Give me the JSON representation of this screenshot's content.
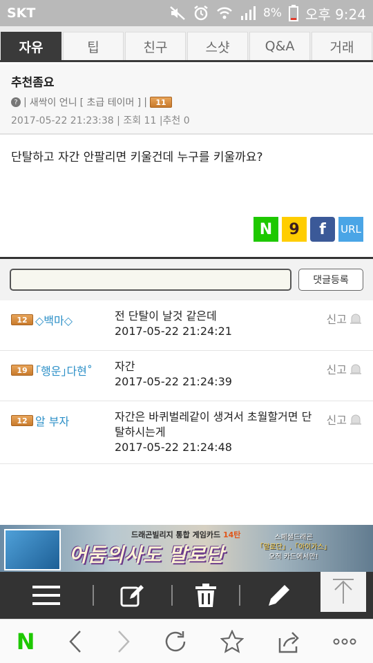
{
  "status_bar": {
    "carrier": "SKT",
    "battery": "8%",
    "time": "오후 9:24"
  },
  "tabs": [
    {
      "label": "자유",
      "active": true
    },
    {
      "label": "팁",
      "active": false
    },
    {
      "label": "친구",
      "active": false
    },
    {
      "label": "스샷",
      "active": false
    },
    {
      "label": "Q&A",
      "active": false
    },
    {
      "label": "거래",
      "active": false
    }
  ],
  "post": {
    "title": "추천좀요",
    "author_prefix": "|",
    "author": "새싹이 언니",
    "rank": "[ 초급 테이머 ]",
    "level_sep": "|",
    "level": "11",
    "date": "2017-05-22 21:23:38",
    "views_label": "| 조회 11",
    "recommend_label": "|추천 0",
    "body": "단탈하고 자간 안팔리면 키울건데 누구를 키울까요?"
  },
  "share": {
    "naver": "N",
    "kakao": "9",
    "facebook": "f",
    "url": "URL"
  },
  "comment_form": {
    "placeholder": "",
    "submit_label": "댓글등록"
  },
  "comments": [
    {
      "level": "12",
      "user": "◇백마◇",
      "text": "전 단탈이 날것 같은데",
      "date": "2017-05-22 21:24:21",
      "report": "신고"
    },
    {
      "level": "19",
      "user": "｢행운｣다현˚",
      "text": "자간",
      "date": "2017-05-22 21:24:39",
      "report": "신고"
    },
    {
      "level": "12",
      "user": "알 부자",
      "text": "자간은 바퀴벌레같이 생겨서 초월할거면 단탈하시는게",
      "date": "2017-05-22 21:24:48",
      "report": "신고"
    }
  ],
  "ad": {
    "top_line_prefix": "드래곤빌리지 통합 게임카드",
    "top_line_highlight": "14탄",
    "logo": "어둠의사도 말로단",
    "side_line1": "스페셜드래곤",
    "side_line2a": "「말로단」",
    "side_line2b": ",「아이가스」",
    "side_line3": "오직 카드에서만!"
  },
  "toolbar": {
    "icons": [
      "menu-icon",
      "edit-note-icon",
      "trash-icon",
      "pencil-icon",
      "scroll-top-icon"
    ]
  },
  "browser_nav": {
    "icons": [
      "naver-home-icon",
      "back-icon",
      "forward-icon",
      "reload-icon",
      "star-icon",
      "share-icon",
      "more-icon"
    ],
    "home_label": "N"
  }
}
